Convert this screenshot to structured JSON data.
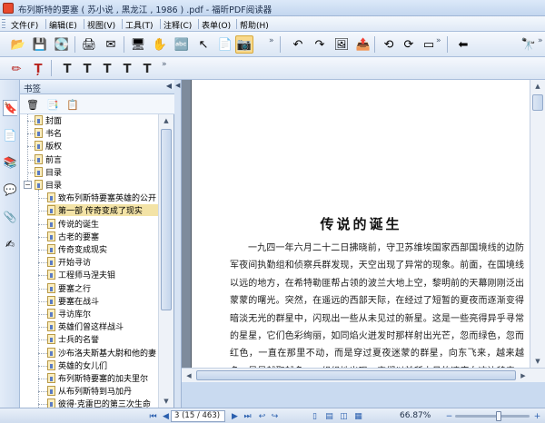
{
  "window": {
    "title": "布列斯特的要塞 ( 苏小说 , 黑龙江 , 1986 ) .pdf - 福昕PDF阅读器"
  },
  "menu": [
    {
      "label": "文件(F)",
      "name": "menu-file"
    },
    {
      "label": "编辑(E)",
      "name": "menu-edit"
    },
    {
      "label": "视图(V)",
      "name": "menu-view"
    },
    {
      "label": "工具(T)",
      "name": "menu-tools"
    },
    {
      "label": "注释(C)",
      "name": "menu-comment"
    },
    {
      "label": "表单(O)",
      "name": "menu-form"
    },
    {
      "label": "帮助(H)",
      "name": "menu-help"
    }
  ],
  "toolbar1": [
    {
      "icon": "open-folder-icon",
      "glyph": "📂",
      "name": "open-button"
    },
    {
      "icon": "save-icon",
      "glyph": "💾",
      "name": "save-button"
    },
    {
      "icon": "save-as-icon",
      "glyph": "💽",
      "name": "save-as-button"
    },
    {
      "icon": "print-icon",
      "glyph": "🖨",
      "name": "print-button"
    },
    {
      "icon": "email-icon",
      "glyph": "✉",
      "name": "email-button"
    },
    {
      "icon": "full-screen-icon",
      "glyph": "🖥",
      "name": "full-screen-button"
    },
    {
      "icon": "hand-tool-icon",
      "glyph": "✋",
      "name": "hand-tool-button"
    },
    {
      "icon": "select-text-icon",
      "glyph": "🔤",
      "name": "select-text-button"
    },
    {
      "icon": "select-icon",
      "glyph": "↖",
      "name": "select-button"
    },
    {
      "icon": "snapshot-doc-icon",
      "glyph": "📄",
      "name": "snapshot-doc-button"
    },
    {
      "icon": "camera-icon",
      "glyph": "📷",
      "name": "snapshot-button"
    },
    {
      "icon": "undo-icon",
      "glyph": "↶",
      "name": "undo-button"
    },
    {
      "icon": "redo-icon",
      "glyph": "↷",
      "name": "redo-button"
    },
    {
      "icon": "insert-image-icon",
      "glyph": "🖼",
      "name": "image-button"
    },
    {
      "icon": "export-icon",
      "glyph": "📤",
      "name": "export-button"
    },
    {
      "icon": "rotate-left-icon",
      "glyph": "⟲",
      "name": "rotate-left-button"
    },
    {
      "icon": "rotate-right-icon",
      "glyph": "⟳",
      "name": "rotate-right-button"
    },
    {
      "icon": "page-view-icon",
      "glyph": "▭",
      "name": "page-view-button"
    },
    {
      "icon": "back-arrow-icon",
      "glyph": "⬅",
      "name": "back-button"
    },
    {
      "icon": "binoculars-icon",
      "glyph": "🔭",
      "name": "find-button"
    }
  ],
  "toolbar2": [
    {
      "icon": "note-pencil-icon",
      "glyph": "✏",
      "name": "note-button"
    },
    {
      "icon": "text-callout-icon",
      "glyph": "Ț",
      "name": "callout-button"
    },
    {
      "icon": "typewriter-icon",
      "glyph": "T",
      "name": "typewriter-button"
    },
    {
      "icon": "text-box-icon",
      "glyph": "T",
      "name": "textbox-button"
    },
    {
      "icon": "text-highlight-icon",
      "glyph": "T",
      "name": "highlight-button"
    },
    {
      "icon": "text-strikeout-icon",
      "glyph": "T",
      "name": "strikeout-button"
    },
    {
      "icon": "text-underline-icon",
      "glyph": "T",
      "name": "underline-button"
    }
  ],
  "bookmarks": {
    "panel_title": "书签",
    "tools": [
      {
        "icon": "delete-bookmark-icon",
        "glyph": "🗑",
        "name": "delete-bookmark-button"
      },
      {
        "icon": "add-bookmark-icon",
        "glyph": "📑",
        "name": "add-bookmark-button"
      },
      {
        "icon": "bookmark-properties-icon",
        "glyph": "📋",
        "name": "bookmark-properties-button"
      }
    ],
    "sidetabs": [
      {
        "icon": "bookmarks-tab-icon",
        "glyph": "🔖",
        "name": "tab-bookmarks"
      },
      {
        "icon": "pages-tab-icon",
        "glyph": "📄",
        "name": "tab-pages"
      },
      {
        "icon": "layers-tab-icon",
        "glyph": "📚",
        "name": "tab-layers"
      },
      {
        "icon": "comments-tab-icon",
        "glyph": "💬",
        "name": "tab-comments"
      },
      {
        "icon": "attachments-tab-icon",
        "glyph": "📎",
        "name": "tab-attachments"
      },
      {
        "icon": "signatures-tab-icon",
        "glyph": "✍",
        "name": "tab-signatures"
      }
    ],
    "top_items": [
      "封面",
      "书名",
      "版权",
      "前言",
      "目录"
    ],
    "expanded": "目录",
    "children": [
      "致布列斯特要塞英雄的公开",
      "第一部  传奇变成了现实",
      "传说的诞生",
      "古老的要塞",
      "传奇变成现实",
      "开始寻访",
      "工程师马涅夫钼",
      "要塞之行",
      "要塞在战斗",
      "寻访库尔",
      "英雄们曾这样战斗",
      "士兵的名誉",
      "沙布洛夫斯基大尉和他的妻",
      "英雄的女儿们",
      "布列斯特要塞的加夫里尔",
      "从布列斯特到马加丹",
      "彼得·克雷巴的第三次生命"
    ],
    "selected_index": 1
  },
  "document": {
    "heading": "传说的诞生",
    "paragraph": "一九四一年六月二十二日拂晓前，守卫苏维埃国家西部国境线的边防军夜间执勤组和侦察兵群发现，天空出现了异常的现象。前面，在国境线以远的地方，在希特勒匪帮占领的波兰大地上空，黎明前的天幕刚刚泛出蒙蒙的曙光。突然，在遥远的西部天际，在经过了短暂的夏夜而逐渐变得暗淡无光的群星中，闪现出一些从未见过的新星。这是一些亮得异乎寻常的星星，它们色彩绚丽，如同焰火迸发时那样射出光芒，忽而绿色，忽而红色，一直在那里不动，而是穿过夏夜迷蒙的群星，向东飞来，越来越多，星星越聚越多，一组组地出现，它们以前所未见的速度向这边移来，发出响声。"
  },
  "status": {
    "page_display": "3 (15 / 463)",
    "zoom": "66.87%",
    "zoom_fraction": 0.58,
    "nav": [
      {
        "icon": "first-page-icon",
        "glyph": "⏮",
        "name": "first-page-button"
      },
      {
        "icon": "prev-page-icon",
        "glyph": "◀",
        "name": "prev-page-button"
      },
      {
        "icon": "next-page-icon",
        "glyph": "▶",
        "name": "next-page-button"
      },
      {
        "icon": "last-page-icon",
        "glyph": "⏭",
        "name": "last-page-button"
      },
      {
        "icon": "back-view-icon",
        "glyph": "↩",
        "name": "prev-view-button"
      },
      {
        "icon": "forward-view-icon",
        "glyph": "↪",
        "name": "next-view-button"
      }
    ],
    "view_modes": [
      {
        "icon": "single-page-icon",
        "glyph": "▯",
        "name": "single-page-button"
      },
      {
        "icon": "continuous-icon",
        "glyph": "▤",
        "name": "continuous-button"
      },
      {
        "icon": "facing-icon",
        "glyph": "◫",
        "name": "facing-button"
      },
      {
        "icon": "continuous-facing-icon",
        "glyph": "▦",
        "name": "continuous-facing-button"
      }
    ]
  }
}
